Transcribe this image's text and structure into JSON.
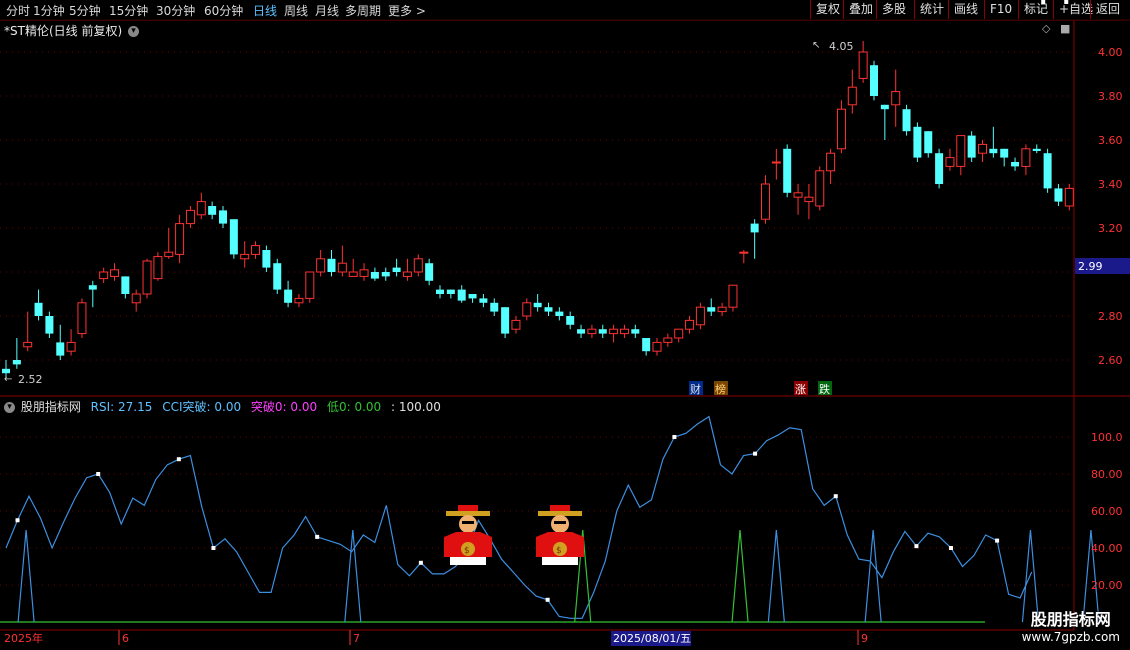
{
  "toolbar": {
    "timeframes": [
      "分时",
      "1分钟",
      "5分钟",
      "15分钟",
      "30分钟",
      "60分钟",
      "日线",
      "周线",
      "月线",
      "多周期",
      "更多"
    ],
    "more_arrow": ">",
    "right_buttons": [
      "复权",
      "叠加",
      "多股",
      "统计",
      "画线",
      "F10",
      "标记",
      "+自选",
      "返回"
    ]
  },
  "chart_title": "*ST精伦(日线 前复权)",
  "price_axis": {
    "ticks": [
      "4.00",
      "3.80",
      "3.60",
      "3.40",
      "3.20",
      "2.80",
      "2.60"
    ],
    "current": "2.99"
  },
  "annotations": {
    "high": "4.05",
    "low": "2.52",
    "tags": [
      "财",
      "榜",
      "涨",
      "跌"
    ]
  },
  "indicator": {
    "name": "股朋指标网",
    "rsi": "RSI: 27.15",
    "cci": "CCI突破: 0.00",
    "breakout": "突破0: 0.00",
    "low": "低0: 0.00",
    "hundred": ": 100.00",
    "axis_ticks": [
      "100.0",
      "80.00",
      "60.00",
      "40.00",
      "20.00"
    ]
  },
  "date_axis": {
    "labels": [
      "2025年",
      "6",
      "7",
      "2025/08/01/五",
      "9"
    ]
  },
  "watermark": {
    "line1": "股朋指标网",
    "line2": "www.7gpzb.com"
  },
  "colors": {
    "up": "#ff3232",
    "down": "#54ffff",
    "rsi": "#3d8fe0",
    "cci": "#34c234",
    "axis": "#8b0000"
  },
  "chart_data": {
    "type": "candlestick",
    "y_range": [
      2.5,
      4.12
    ],
    "candles": [
      [
        2.56,
        2.6,
        2.54,
        2.52
      ],
      [
        2.6,
        2.7,
        2.58,
        2.56
      ],
      [
        2.66,
        2.82,
        2.68,
        2.64
      ],
      [
        2.86,
        2.92,
        2.8,
        2.78
      ],
      [
        2.8,
        2.82,
        2.72,
        2.7
      ],
      [
        2.68,
        2.76,
        2.62,
        2.6
      ],
      [
        2.64,
        2.74,
        2.68,
        2.62
      ],
      [
        2.72,
        2.88,
        2.86,
        2.7
      ],
      [
        2.94,
        2.96,
        2.92,
        2.84
      ],
      [
        2.97,
        3.02,
        3.0,
        2.95
      ],
      [
        2.98,
        3.04,
        3.01,
        2.96
      ],
      [
        2.98,
        2.98,
        2.9,
        2.88
      ],
      [
        2.86,
        2.92,
        2.9,
        2.82
      ],
      [
        2.9,
        3.06,
        3.05,
        2.88
      ],
      [
        2.97,
        3.09,
        3.07,
        2.96
      ],
      [
        3.07,
        3.2,
        3.09,
        3.06
      ],
      [
        3.08,
        3.26,
        3.22,
        3.04
      ],
      [
        3.22,
        3.3,
        3.28,
        3.2
      ],
      [
        3.26,
        3.36,
        3.32,
        3.24
      ],
      [
        3.3,
        3.32,
        3.26,
        3.24
      ],
      [
        3.28,
        3.3,
        3.22,
        3.2
      ],
      [
        3.24,
        3.24,
        3.08,
        3.06
      ],
      [
        3.06,
        3.14,
        3.08,
        3.02
      ],
      [
        3.08,
        3.14,
        3.12,
        3.06
      ],
      [
        3.1,
        3.12,
        3.02,
        3.0
      ],
      [
        3.04,
        3.06,
        2.92,
        2.9
      ],
      [
        2.92,
        2.96,
        2.86,
        2.84
      ],
      [
        2.86,
        2.9,
        2.88,
        2.84
      ],
      [
        2.88,
        3.0,
        3.0,
        2.86
      ],
      [
        3.0,
        3.1,
        3.06,
        2.98
      ],
      [
        3.06,
        3.1,
        3.0,
        2.98
      ],
      [
        3.0,
        3.12,
        3.04,
        2.98
      ],
      [
        2.98,
        3.06,
        3.0,
        2.98
      ],
      [
        2.98,
        3.04,
        3.01,
        2.96
      ],
      [
        3.0,
        3.02,
        2.97,
        2.96
      ],
      [
        3.0,
        3.02,
        2.98,
        2.96
      ],
      [
        3.02,
        3.06,
        3.0,
        2.98
      ],
      [
        2.98,
        3.06,
        3.0,
        2.96
      ],
      [
        3.0,
        3.08,
        3.06,
        2.98
      ],
      [
        3.04,
        3.06,
        2.96,
        2.94
      ],
      [
        2.92,
        2.94,
        2.9,
        2.88
      ],
      [
        2.92,
        2.92,
        2.9,
        2.88
      ],
      [
        2.92,
        2.94,
        2.87,
        2.86
      ],
      [
        2.9,
        2.9,
        2.88,
        2.86
      ],
      [
        2.88,
        2.9,
        2.86,
        2.84
      ],
      [
        2.86,
        2.88,
        2.82,
        2.8
      ],
      [
        2.84,
        2.84,
        2.72,
        2.7
      ],
      [
        2.74,
        2.8,
        2.78,
        2.72
      ],
      [
        2.8,
        2.88,
        2.86,
        2.78
      ],
      [
        2.86,
        2.9,
        2.84,
        2.82
      ],
      [
        2.84,
        2.86,
        2.82,
        2.8
      ],
      [
        2.82,
        2.84,
        2.8,
        2.78
      ],
      [
        2.8,
        2.82,
        2.76,
        2.74
      ],
      [
        2.74,
        2.76,
        2.72,
        2.7
      ],
      [
        2.72,
        2.76,
        2.74,
        2.7
      ],
      [
        2.74,
        2.76,
        2.72,
        2.7
      ],
      [
        2.72,
        2.76,
        2.74,
        2.68
      ],
      [
        2.72,
        2.76,
        2.74,
        2.7
      ],
      [
        2.74,
        2.76,
        2.72,
        2.7
      ],
      [
        2.7,
        2.7,
        2.64,
        2.62
      ],
      [
        2.64,
        2.7,
        2.68,
        2.62
      ],
      [
        2.68,
        2.72,
        2.7,
        2.66
      ],
      [
        2.7,
        2.74,
        2.74,
        2.68
      ],
      [
        2.74,
        2.8,
        2.78,
        2.72
      ],
      [
        2.76,
        2.86,
        2.84,
        2.74
      ],
      [
        2.84,
        2.88,
        2.82,
        2.8
      ],
      [
        2.82,
        2.86,
        2.84,
        2.8
      ],
      [
        2.84,
        2.94,
        2.94,
        2.82
      ],
      [
        3.09,
        3.1,
        3.09,
        3.04
      ],
      [
        3.22,
        3.24,
        3.18,
        3.06
      ],
      [
        3.24,
        3.44,
        3.4,
        3.22
      ],
      [
        3.5,
        3.56,
        3.5,
        3.42
      ],
      [
        3.56,
        3.58,
        3.36,
        3.34
      ],
      [
        3.34,
        3.4,
        3.36,
        3.26
      ],
      [
        3.32,
        3.4,
        3.34,
        3.24
      ],
      [
        3.3,
        3.48,
        3.46,
        3.28
      ],
      [
        3.46,
        3.56,
        3.54,
        3.4
      ],
      [
        3.56,
        3.78,
        3.74,
        3.54
      ],
      [
        3.76,
        3.92,
        3.84,
        3.72
      ],
      [
        3.88,
        4.05,
        4.0,
        3.86
      ],
      [
        3.94,
        3.96,
        3.8,
        3.78
      ],
      [
        3.76,
        3.76,
        3.74,
        3.6
      ],
      [
        3.76,
        3.92,
        3.82,
        3.66
      ],
      [
        3.74,
        3.76,
        3.64,
        3.62
      ],
      [
        3.66,
        3.68,
        3.52,
        3.5
      ],
      [
        3.64,
        3.64,
        3.54,
        3.52
      ],
      [
        3.54,
        3.56,
        3.4,
        3.38
      ],
      [
        3.48,
        3.56,
        3.52,
        3.46
      ],
      [
        3.48,
        3.62,
        3.62,
        3.44
      ],
      [
        3.62,
        3.64,
        3.52,
        3.5
      ],
      [
        3.54,
        3.6,
        3.58,
        3.5
      ],
      [
        3.56,
        3.66,
        3.54,
        3.52
      ],
      [
        3.56,
        3.56,
        3.52,
        3.48
      ],
      [
        3.5,
        3.52,
        3.48,
        3.46
      ],
      [
        3.48,
        3.58,
        3.56,
        3.44
      ],
      [
        3.56,
        3.58,
        3.55,
        3.54
      ],
      [
        3.54,
        3.56,
        3.38,
        3.36
      ],
      [
        3.38,
        3.4,
        3.32,
        3.3
      ],
      [
        3.3,
        3.4,
        3.38,
        3.28
      ]
    ],
    "rsi": [
      40,
      55,
      68,
      56,
      40,
      54,
      67,
      78,
      80,
      70,
      53,
      67,
      63,
      77,
      85,
      88,
      90,
      62,
      40,
      45,
      38,
      27,
      16,
      16,
      40,
      47,
      57,
      46,
      44,
      42,
      38,
      47,
      43,
      63,
      31,
      25,
      32,
      26,
      26,
      30,
      38,
      55,
      45,
      34,
      27,
      20,
      14,
      12,
      3,
      2,
      2,
      16,
      33,
      60,
      74,
      62,
      66,
      88,
      100,
      102,
      107,
      111,
      85,
      80,
      90,
      91,
      98,
      101,
      105,
      104,
      72,
      63,
      68,
      47,
      34,
      33,
      24,
      38,
      49,
      41,
      48,
      46,
      40,
      30,
      36,
      47,
      44,
      15,
      13,
      27
    ],
    "cci_spikes": [
      1,
      28,
      47,
      60,
      63,
      71,
      84,
      89
    ],
    "white_markers": [
      1,
      8,
      15,
      18,
      27,
      36,
      47,
      58,
      65,
      72,
      79,
      82,
      86,
      90,
      92,
      98
    ]
  }
}
